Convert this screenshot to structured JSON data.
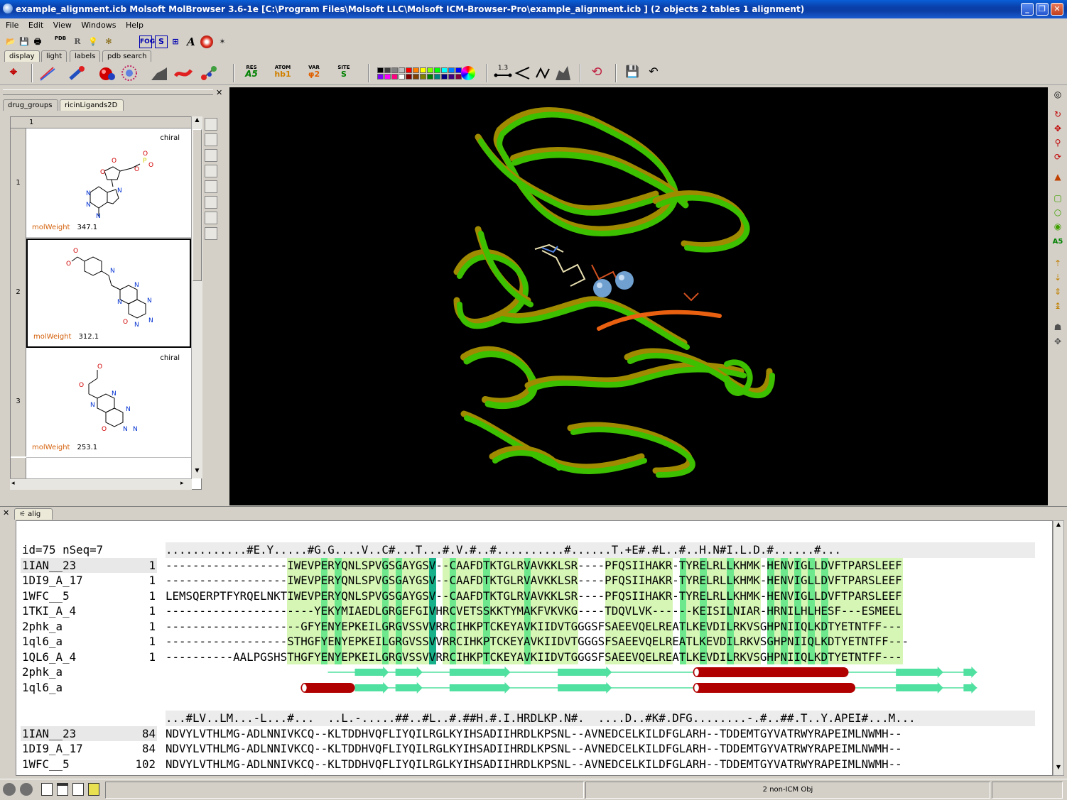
{
  "window": {
    "title": "example_alignment.icb Molsoft MolBrowser 3.6-1e  [C:\\Program Files\\Molsoft LLC\\Molsoft ICM-Browser-Pro\\example_alignment.icb ] (2 objects 2 tables 1 alignment)",
    "min_btn": "_",
    "max_btn": "❐",
    "close_btn": "✕"
  },
  "menu": [
    "File",
    "Edit",
    "View",
    "Windows",
    "Help"
  ],
  "toolbar1": {
    "pdb": "PDB",
    "r": "R",
    "fog": "FOG",
    "s": "S",
    "a": "A"
  },
  "tabs": [
    "display",
    "light",
    "labels",
    "pdb search"
  ],
  "toolbar2": {
    "res": "RES",
    "res_sub": "A5",
    "atom": "ATOM",
    "atom_sub": "hb1",
    "var": "VAR",
    "var_sub": "φ2",
    "site": "SITE",
    "site_sub": "S",
    "dist": "1.3"
  },
  "palette": [
    "#000000",
    "#404040",
    "#808080",
    "#c0c0c0",
    "#ff0000",
    "#ff8000",
    "#ffff00",
    "#80ff00",
    "#00ff00",
    "#00ffff",
    "#0080ff",
    "#0000ff",
    "#8000ff",
    "#ff00ff",
    "#ff0080",
    "#ffffff",
    "#800000",
    "#804000",
    "#808000",
    "#008000",
    "#008080",
    "#000080",
    "#400080",
    "#800040"
  ],
  "left_panel": {
    "tabs": [
      "drug_groups",
      "ricinLigands2D"
    ],
    "column_header": "1",
    "rows": [
      {
        "num": "1",
        "chiral": "chiral",
        "mw_label": "molWeight",
        "mw_value": "347.1"
      },
      {
        "num": "2",
        "chiral": "",
        "mw_label": "molWeight",
        "mw_value": "312.1"
      },
      {
        "num": "3",
        "chiral": "chiral",
        "mw_label": "molWeight",
        "mw_value": "253.1"
      }
    ]
  },
  "alignment": {
    "tab": "alig",
    "header": "id=75 nSeq=7",
    "block1": {
      "consensus": "............#E.Y.....#G.G....V..C#...T...#.V.#..#..........#......T.+E#.#L..#..H.N#I.L.D.#......#...",
      "rows": [
        {
          "name": "1IAN__23",
          "start": "1",
          "seq": "------------------IWEVPERYQNLSPVGSGAYGSV--CAAFDTKTGLRVAVKKLSR----PFQSIIHAKR-TYRELRLLKHMK-HENVIGLLDVFTPARSLEEF"
        },
        {
          "name": "1DI9_A_17",
          "start": "1",
          "seq": "------------------IWEVPERYQNLSPVGSGAYGSV--CAAFDTKTGLRVAVKKLSR----PFQSIIHAKR-TYRELRLLKHMK-HENVIGLLDVFTPARSLEEF"
        },
        {
          "name": "1WFC__5",
          "start": "1",
          "seq": "LEMSQERPTFYRQELNKTIWEVPERYQNLSPVGSGAYGSV--CAAFDTKTGLRVAVKKLSR----PFQSIIHAKR-TYRELRLLKHMK-HENVIGLLDVFTPARSLEEF"
        },
        {
          "name": "1TKI_A_4",
          "start": "1",
          "seq": "----------------------YEKYMIAEDLGRGEFGIVHRCVETSSKKTYMAKFVKVKG----TDQVLVK------KEISILNIAR-HRNILHLHESF---ESMEEL"
        },
        {
          "name": "2phk_a",
          "start": "1",
          "seq": "--------------------GFYENYEPKEILGRGVSSVVRRCIHKPTCKEYAVKIIDVTGGGSFSAEEVQELREATLKEVDILRKVSGHPNIIQLKDTYETNTFF---"
        },
        {
          "name": "1ql6_a",
          "start": "1",
          "seq": "------------------STHGFYENYEPKEILGRGVSSVVRRCIHKPTCKEYAVKIIDVTGGGSFSAEEVQELREATLKEVDILRKVSGHPNIIQLKDTYETNTFF---"
        },
        {
          "name": "1QL6_A_4",
          "start": "1",
          "seq": "----------AALPGSHSTHGFYENYEPKEILGRGVSSVVRRCIHKPTCKEYAVKIIDVTGGGSFSAEEVQELREATLKEVDILRKVSGHPNIIQLKDTYETNTFF---"
        }
      ],
      "ss_rows": [
        {
          "name": "2phk_a"
        },
        {
          "name": "1ql6_a"
        }
      ]
    },
    "block2": {
      "consensus": "...#LV..LM...-L...#...  ..L.-.....##..#L..#.##H.#.I.HRDLKP.N#.  ....D..#K#.DFG........-.#..##.T..Y.APEI#...M...",
      "rows": [
        {
          "name": "1IAN__23",
          "start": "84",
          "seq": "NDVYLVTHLMG-ADLNNIVKCQ--KLTDDHVQFLIYQILRGLKYIHSADIIHRDLKPSNL--AVNEDCELKILDFGLARH--TDDEMTGYVATRWYRAPEIMLNWMH--"
        },
        {
          "name": "1DI9_A_17",
          "start": "84",
          "seq": "NDVYLVTHLMG-ADLNNIVKCQ--KLTDDHVQFLIYQILRGLKYIHSADIIHRDLKPSNL--AVNEDCELKILDFGLARH--TDDEMTGYVATRWYRAPEIMLNWMH--"
        },
        {
          "name": "1WFC__5",
          "start": "102",
          "seq": "NDVYLVTHLMG-ADLNNIVKCQ--KLTDDHVQFLIYQILRGLKYIHSADIIHRDLKPSNL--AVNEDCELKILDFGLARH--TDDEMTGYVATRWYRAPEIMLNWMH--"
        }
      ]
    }
  },
  "status": {
    "right": "2 non-ICM Obj"
  },
  "colors": {
    "strong": "#18b08a",
    "medium": "#6ee88c",
    "light": "#d6f6b6",
    "helix": "#b00000",
    "strand": "#50e0a0",
    "green_ribbon": "#3cc000",
    "gold_ribbon": "#a08a00"
  }
}
